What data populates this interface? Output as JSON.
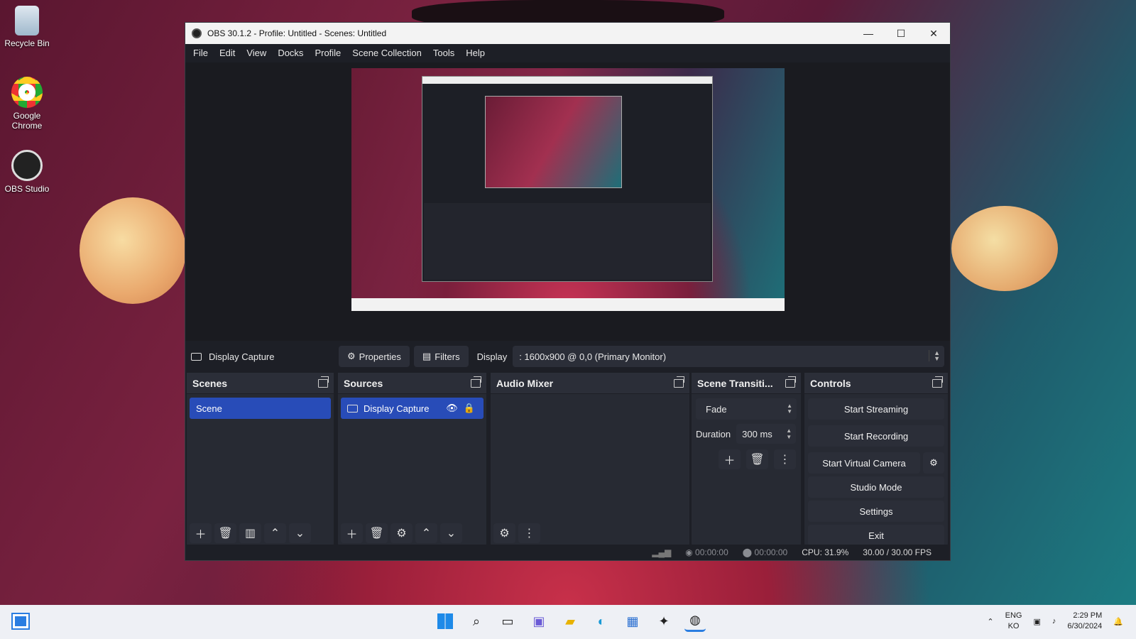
{
  "desktop": {
    "icons": [
      {
        "label": "Recycle Bin"
      },
      {
        "label": "Google Chrome"
      },
      {
        "label": "OBS Studio"
      }
    ]
  },
  "window": {
    "title": "OBS 30.1.2 - Profile: Untitled - Scenes: Untitled",
    "min": "—",
    "max": "☐",
    "close": "✕"
  },
  "menu": [
    "File",
    "Edit",
    "View",
    "Docks",
    "Profile",
    "Scene Collection",
    "Tools",
    "Help"
  ],
  "sourcebar": {
    "source_name": "Display Capture",
    "properties": "Properties",
    "filters": "Filters",
    "display_label": "Display",
    "display_value": ": 1600x900 @ 0,0 (Primary Monitor)"
  },
  "scenes": {
    "title": "Scenes",
    "items": [
      "Scene"
    ]
  },
  "sources": {
    "title": "Sources",
    "items": [
      "Display Capture"
    ]
  },
  "mixer": {
    "title": "Audio Mixer"
  },
  "transitions": {
    "title": "Scene Transiti...",
    "selected": "Fade",
    "duration_label": "Duration",
    "duration_value": "300 ms"
  },
  "controls": {
    "title": "Controls",
    "buttons": [
      "Start Streaming",
      "Start Recording",
      "Start Virtual Camera",
      "Studio Mode",
      "Settings",
      "Exit"
    ]
  },
  "status": {
    "stream_time": "00:00:00",
    "rec_time": "00:00:00",
    "cpu": "CPU: 31.9%",
    "fps": "30.00 / 30.00 FPS"
  },
  "taskbar": {
    "lang_top": "ENG",
    "lang_bottom": "KO",
    "time": "2:29 PM",
    "date": "6/30/2024"
  },
  "colors": {
    "accent": "#284cb8",
    "panel": "#272a33",
    "button": "#2b2e38"
  }
}
